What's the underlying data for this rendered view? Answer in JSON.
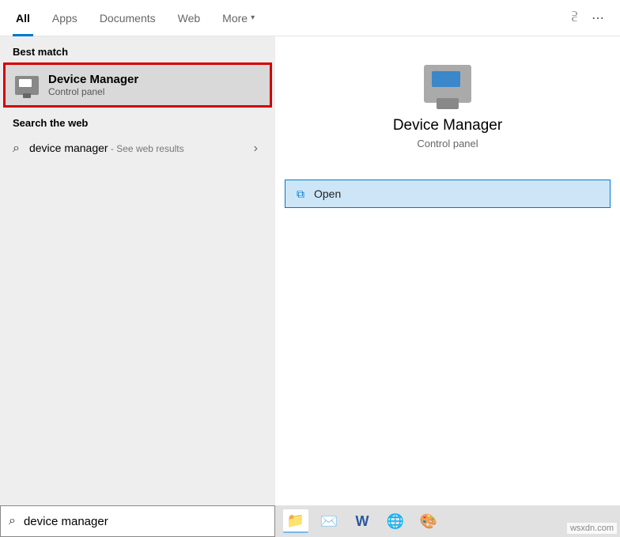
{
  "tabs": {
    "all": "All",
    "apps": "Apps",
    "documents": "Documents",
    "web": "Web",
    "more": "More"
  },
  "sections": {
    "best_match": "Best match",
    "search_web": "Search the web"
  },
  "best": {
    "title": "Device Manager",
    "subtitle": "Control panel"
  },
  "web_result": {
    "query": "device manager",
    "suffix": " - See web results"
  },
  "hero": {
    "title": "Device Manager",
    "subtitle": "Control panel"
  },
  "actions": {
    "open": "Open"
  },
  "search": {
    "value": "device manager"
  },
  "watermark": "wsxdn.com"
}
